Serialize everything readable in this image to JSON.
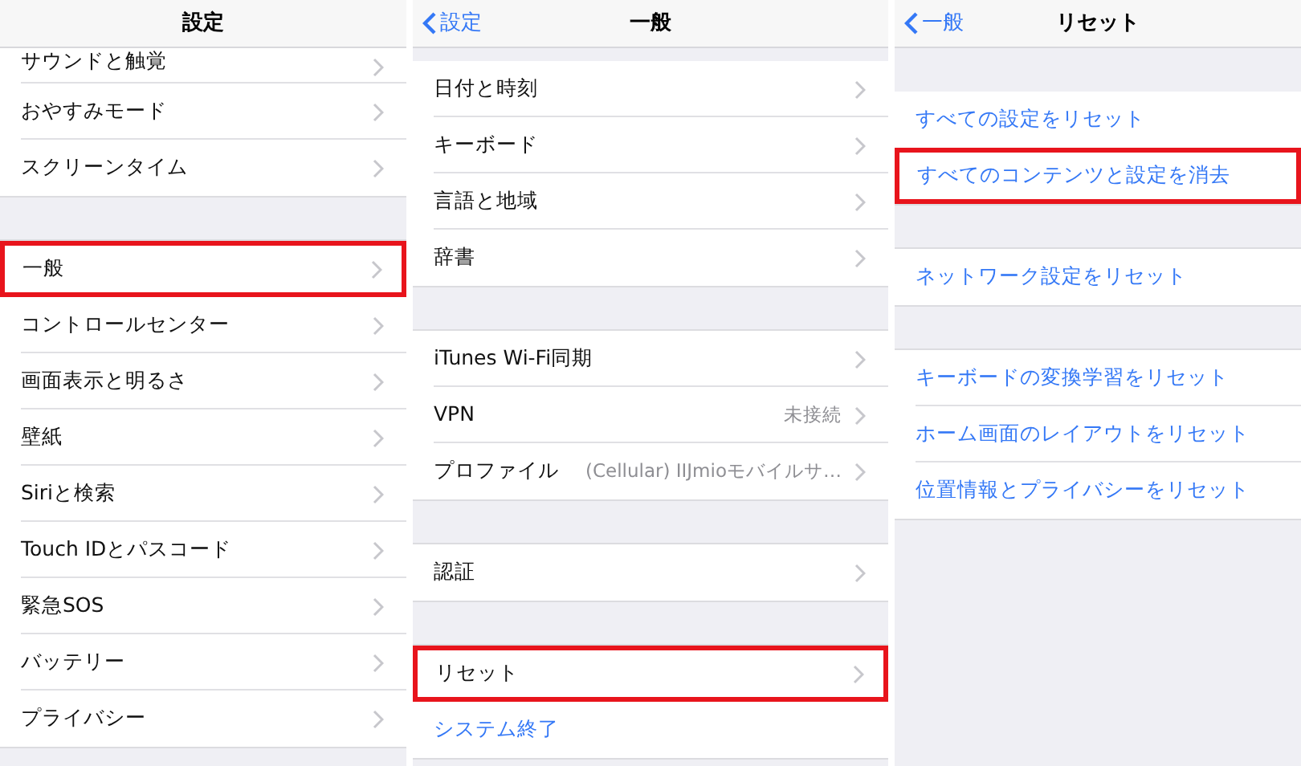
{
  "panels": [
    {
      "title": "設定",
      "groups": [
        {
          "rows": [
            {
              "label": "サウンドと触覚",
              "kind": "nav",
              "highlighted": false
            },
            {
              "label": "おやすみモード",
              "kind": "nav",
              "highlighted": false
            },
            {
              "label": "スクリーンタイム",
              "kind": "nav",
              "highlighted": false
            }
          ]
        },
        {
          "rows": [
            {
              "label": "一般",
              "kind": "nav",
              "highlighted": true
            },
            {
              "label": "コントロールセンター",
              "kind": "nav",
              "highlighted": false
            },
            {
              "label": "画面表示と明るさ",
              "kind": "nav",
              "highlighted": false
            },
            {
              "label": "壁紙",
              "kind": "nav",
              "highlighted": false
            },
            {
              "label": "Siriと検索",
              "kind": "nav",
              "highlighted": false
            },
            {
              "label": "Touch IDとパスコード",
              "kind": "nav",
              "highlighted": false
            },
            {
              "label": "緊急SOS",
              "kind": "nav",
              "highlighted": false
            },
            {
              "label": "バッテリー",
              "kind": "nav",
              "highlighted": false
            },
            {
              "label": "プライバシー",
              "kind": "nav",
              "highlighted": false
            }
          ]
        }
      ]
    },
    {
      "title": "一般",
      "back": "設定",
      "groups": [
        {
          "rows": [
            {
              "label": "日付と時刻",
              "kind": "nav",
              "highlighted": false
            },
            {
              "label": "キーボード",
              "kind": "nav",
              "highlighted": false
            },
            {
              "label": "言語と地域",
              "kind": "nav",
              "highlighted": false
            },
            {
              "label": "辞書",
              "kind": "nav",
              "highlighted": false
            }
          ]
        },
        {
          "rows": [
            {
              "label": "iTunes Wi-Fi同期",
              "kind": "nav",
              "highlighted": false
            },
            {
              "label": "VPN",
              "detail": "未接続",
              "kind": "nav",
              "highlighted": false
            },
            {
              "label": "プロファイル",
              "detail": "(Cellular) IIJmioモバイルサ…",
              "kind": "nav",
              "highlighted": false
            }
          ]
        },
        {
          "rows": [
            {
              "label": "認証",
              "kind": "nav",
              "highlighted": false
            }
          ]
        },
        {
          "rows": [
            {
              "label": "リセット",
              "kind": "nav",
              "highlighted": true
            },
            {
              "label": "システム終了",
              "kind": "action",
              "highlighted": false
            }
          ]
        }
      ]
    },
    {
      "title": "リセット",
      "back": "一般",
      "groups": [
        {
          "rows": [
            {
              "label": "すべての設定をリセット",
              "kind": "action",
              "highlighted": false
            },
            {
              "label": "すべてのコンテンツと設定を消去",
              "kind": "action",
              "highlighted": true
            }
          ]
        },
        {
          "rows": [
            {
              "label": "ネットワーク設定をリセット",
              "kind": "action",
              "highlighted": false
            }
          ]
        },
        {
          "rows": [
            {
              "label": "キーボードの変換学習をリセット",
              "kind": "action",
              "highlighted": false
            },
            {
              "label": "ホーム画面のレイアウトをリセット",
              "kind": "action",
              "highlighted": false
            },
            {
              "label": "位置情報とプライバシーをリセット",
              "kind": "action",
              "highlighted": false
            }
          ]
        }
      ]
    }
  ]
}
